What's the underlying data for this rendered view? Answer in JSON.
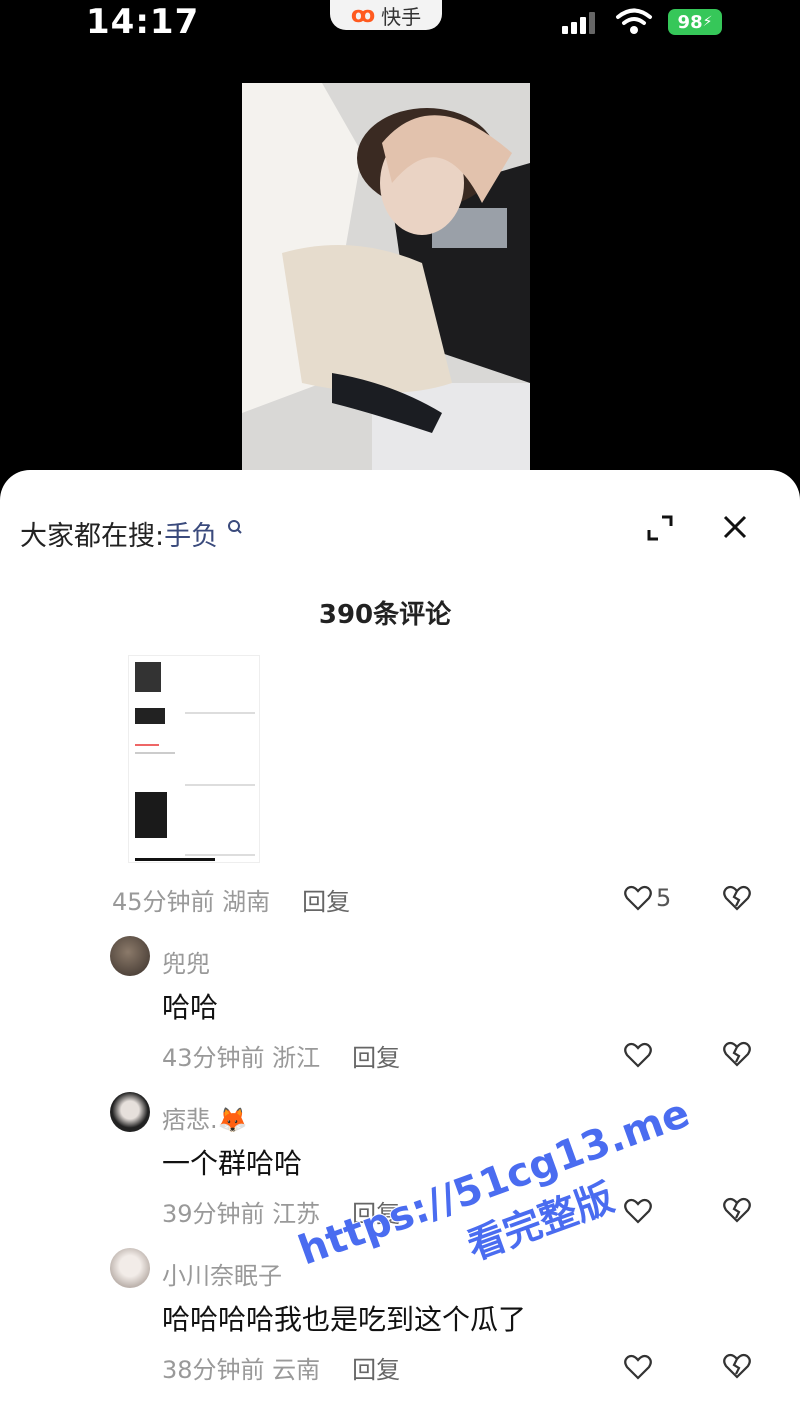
{
  "status_bar": {
    "time": "14:17",
    "app_name": "快手",
    "battery": "98"
  },
  "sheet": {
    "search_prefix": "大家都在搜:",
    "search_term": "手负",
    "comment_count": "390条评论"
  },
  "comments": [
    {
      "meta": "45分钟前 湖南",
      "reply": "回复",
      "likes": "5"
    },
    {
      "username": "兜兜",
      "text": "哈哈",
      "meta": "43分钟前 浙江",
      "reply": "回复"
    },
    {
      "username": "痞悲.🦊",
      "text": "一个群哈哈",
      "meta": "39分钟前 江苏",
      "reply": "回复"
    },
    {
      "username": "小川奈眠子",
      "text": "哈哈哈哈我也是吃到这个瓜了",
      "meta": "38分钟前 云南",
      "reply": "回复"
    }
  ],
  "watermark": {
    "line1": "https://51cg13.me",
    "line2": "看完整版"
  },
  "colors": {
    "accent": "#ff5a1f",
    "battery": "#36c759",
    "watermark": "#4a6cf0"
  }
}
